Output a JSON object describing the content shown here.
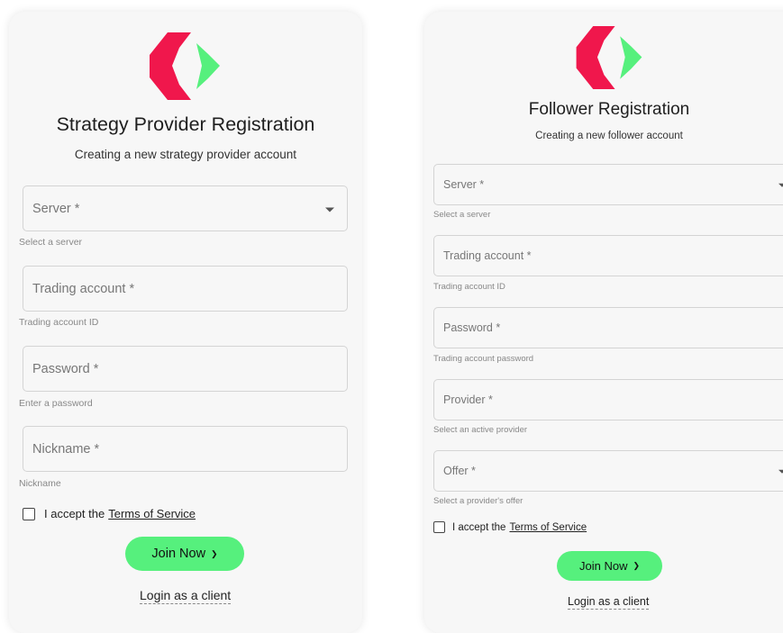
{
  "provider": {
    "title": "Strategy Provider Registration",
    "subtitle": "Creating a new strategy provider account",
    "fields": [
      {
        "placeholder": "Server *",
        "helper": "Select a server"
      },
      {
        "placeholder": "Trading account *",
        "helper": "Trading account ID"
      },
      {
        "placeholder": "Password *",
        "helper": "Enter a password"
      },
      {
        "placeholder": "Nickname *",
        "helper": "Nickname"
      }
    ],
    "terms_prefix": "I accept the",
    "terms_link": "Terms of Service",
    "join_label": "Join Now",
    "login_label": "Login as a client"
  },
  "follower": {
    "title": "Follower Registration",
    "subtitle": "Creating a new follower account",
    "fields": [
      {
        "placeholder": "Server *",
        "helper": "Select a server"
      },
      {
        "placeholder": "Trading account *",
        "helper": "Trading account ID"
      },
      {
        "placeholder": "Password *",
        "helper": "Trading account password"
      },
      {
        "placeholder": "Provider *",
        "helper": "Select an active provider"
      },
      {
        "placeholder": "Offer *",
        "helper": "Select a provider's offer"
      }
    ],
    "terms_prefix": "I accept the",
    "terms_link": "Terms of Service",
    "join_label": "Join Now",
    "login_label": "Login as a client"
  },
  "icons": {
    "logo": "brand-logo-icon",
    "dropdown": "chevron-down-icon",
    "join_arrow": "chevron-right-icon"
  },
  "colors": {
    "logo_red": "#f0174c",
    "logo_green": "#56f07d",
    "button": "#56f07d",
    "card_background": "#f7f7f7"
  }
}
